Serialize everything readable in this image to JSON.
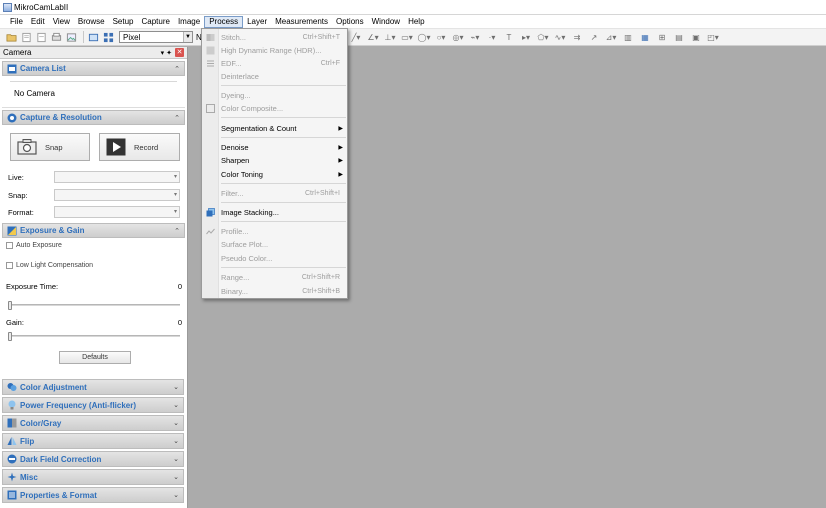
{
  "window": {
    "title": "MikroCamLabII"
  },
  "menu": [
    "File",
    "Edit",
    "View",
    "Browse",
    "Setup",
    "Capture",
    "Image",
    "Process",
    "Layer",
    "Measurements",
    "Options",
    "Window",
    "Help"
  ],
  "toolbar": {
    "unit_value": "Pixel",
    "na_label": "N/A"
  },
  "panel": {
    "title": "Camera",
    "pin_glyph": "▾ ✦",
    "close_glyph": "✕",
    "camera_list": {
      "title": "Camera List",
      "value": "No Camera"
    },
    "capture": {
      "title": "Capture & Resolution",
      "snap_label": "Snap",
      "record_label": "Record",
      "live_label": "Live:",
      "snap_field_label": "Snap:",
      "format_label": "Format:"
    },
    "exposure": {
      "title": "Exposure & Gain",
      "auto_exposure": "Auto Exposure",
      "low_light": "Low Light Compensation",
      "exposure_time_label": "Exposure Time:",
      "exposure_time_value": "0",
      "gain_label": "Gain:",
      "gain_value": "0",
      "defaults_label": "Defaults"
    },
    "collapsed_sections": [
      "Color Adjustment",
      "Power Frequency (Anti-flicker)",
      "Color/Gray",
      "Flip",
      "Dark Field Correction",
      "Misc",
      "Properties & Format"
    ]
  },
  "process_menu": [
    {
      "label": "Stitch...",
      "shortcut": "Ctrl+Shift+T",
      "disabled": true
    },
    {
      "label": "High Dynamic Range (HDR)...",
      "shortcut": "",
      "disabled": true
    },
    {
      "label": "EDF...",
      "shortcut": "Ctrl+F",
      "disabled": true
    },
    {
      "label": "Deinterlace",
      "shortcut": "",
      "disabled": true
    },
    {
      "label": "Dyeing...",
      "shortcut": "",
      "disabled": true
    },
    {
      "label": "Color Composite...",
      "shortcut": "",
      "disabled": true
    },
    {
      "label": "Segmentation & Count",
      "shortcut": "",
      "disabled": false
    },
    {
      "label": "Denoise",
      "shortcut": "",
      "disabled": false
    },
    {
      "label": "Sharpen",
      "shortcut": "",
      "disabled": false
    },
    {
      "label": "Color Toning",
      "shortcut": "",
      "disabled": false
    },
    {
      "label": "Filter...",
      "shortcut": "Ctrl+Shift+I",
      "disabled": true
    },
    {
      "label": "Image Stacking...",
      "shortcut": "",
      "disabled": false
    },
    {
      "label": "Profile...",
      "shortcut": "",
      "disabled": true
    },
    {
      "label": "Surface Plot...",
      "shortcut": "",
      "disabled": true
    },
    {
      "label": "Pseudo Color...",
      "shortcut": "",
      "disabled": true
    },
    {
      "label": "Range...",
      "shortcut": "Ctrl+Shift+R",
      "disabled": true
    },
    {
      "label": "Binary...",
      "shortcut": "Ctrl+Shift+B",
      "disabled": true
    }
  ],
  "submenu_arrow": "▶",
  "collapse_glyph": "⌃",
  "expand_glyph": "⌄"
}
